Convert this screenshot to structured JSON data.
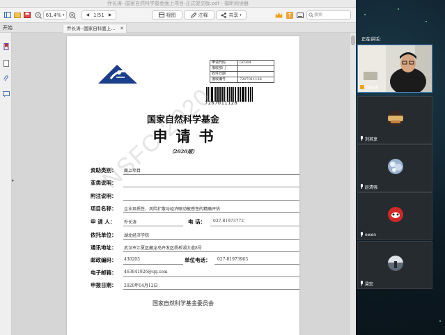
{
  "window": {
    "title": "乔长涛--国家自然科学基金面上项目-正式提交版.pdf - 福昕阅读器"
  },
  "toolbar": {
    "zoom": "61.4%",
    "page_indicator": "1/51",
    "view_label": "视图",
    "annotate_label": "注释",
    "share_label": "共享",
    "search_placeholder": "搜索"
  },
  "tabs": {
    "start_label": "开始",
    "doc_tab_label": "乔长涛--国家自科面上..."
  },
  "document": {
    "info_table": [
      {
        "key": "申请代码",
        "value": "G0304"
      },
      {
        "key": "接收部门",
        "value": ""
      },
      {
        "key": "收件日期",
        "value": ""
      },
      {
        "key": "接收编号",
        "value": "7207011128"
      }
    ],
    "barcode_number": "7207011128",
    "fund_name": "国家自然科学基金",
    "form_title": "申请书",
    "edition": "（2020版）",
    "watermark": "NSFC 2020",
    "fields": {
      "funding_type": {
        "label": "资助类别：",
        "value": "面上项目"
      },
      "subtype": {
        "label": "亚类说明：",
        "value": ""
      },
      "note": {
        "label": "附注说明：",
        "value": ""
      },
      "project_name": {
        "label": "项目名称：",
        "value": "企业异质性、风险扩散与经济联动敏感性的精确评估"
      },
      "applicant": {
        "label": "申  请  人：",
        "value": "乔长涛",
        "label2": "电    话：",
        "value2": "027-81973772"
      },
      "institution": {
        "label": "依托单位：",
        "value": "湖北经济学院"
      },
      "address": {
        "label": "通讯地址：",
        "value": "武汉市江夏区藏龙岛开发区杨桥湖大道8号"
      },
      "postcode": {
        "label": "邮政编码：",
        "value": "430205",
        "label2": "单位电话：",
        "value2": "027-81973963"
      },
      "email": {
        "label": "电子邮箱：",
        "value": "463841926@qq.com"
      },
      "report_date": {
        "label": "申报日期：",
        "value": "2020年04月12日"
      }
    },
    "committee": "国家自然科学基金委员会"
  },
  "meeting": {
    "speaking_label": "正在讲话:",
    "participants": [
      {
        "name": "乔长涛"
      },
      {
        "name": "刘其享"
      },
      {
        "name": "赵清强"
      },
      {
        "name": "owen"
      },
      {
        "name": "梁宏"
      }
    ]
  },
  "colors": {
    "accent": "#4a8fd0",
    "logo_blue": "#1c3f8c"
  }
}
